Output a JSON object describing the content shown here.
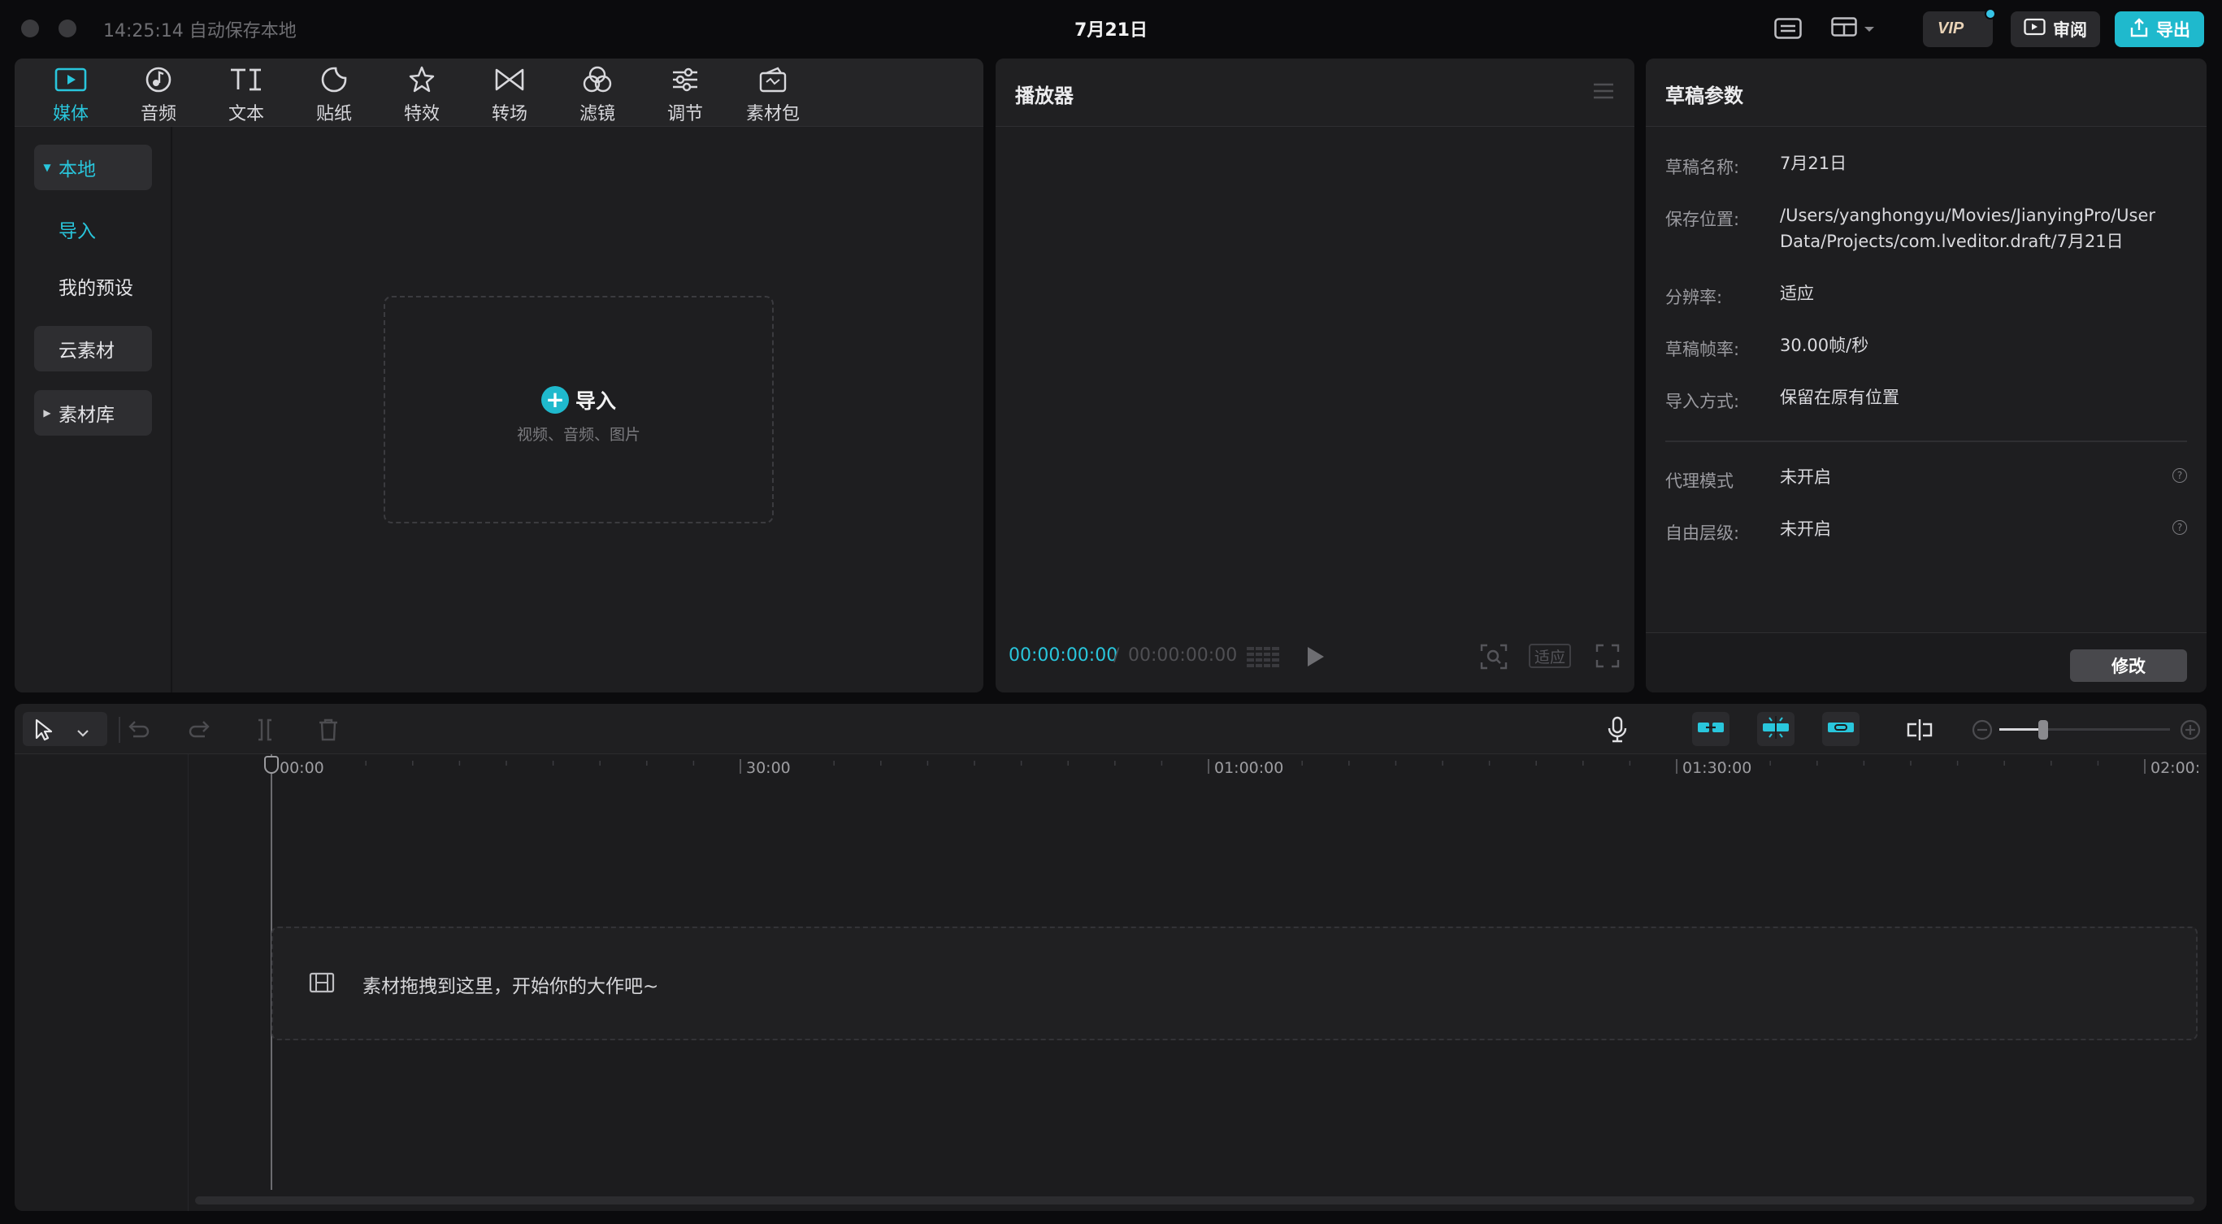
{
  "titlebar": {
    "autosave": "14:25:14 自动保存本地",
    "doc_title": "7月21日",
    "review_label": "审阅",
    "export_label": "导出",
    "vip_label": "VIP"
  },
  "media": {
    "tabs": [
      {
        "label": "媒体",
        "icon": "media-icon",
        "active": true
      },
      {
        "label": "音频",
        "icon": "audio-icon"
      },
      {
        "label": "文本",
        "icon": "text-icon"
      },
      {
        "label": "贴纸",
        "icon": "sticker-icon"
      },
      {
        "label": "特效",
        "icon": "effects-icon"
      },
      {
        "label": "转场",
        "icon": "transition-icon"
      },
      {
        "label": "滤镜",
        "icon": "filter-icon"
      },
      {
        "label": "调节",
        "icon": "adjust-icon"
      },
      {
        "label": "素材包",
        "icon": "asset-pack-icon"
      }
    ],
    "sidebar": {
      "local": "本地",
      "import": "导入",
      "presets": "我的预设",
      "cloud": "云素材",
      "library": "素材库"
    },
    "import_box": {
      "title": "导入",
      "subtitle": "视频、音频、图片"
    }
  },
  "player": {
    "title": "播放器",
    "current_time": "00:00:00:00",
    "separator": "/",
    "total_time": "00:00:00:00",
    "fit_label": "适应"
  },
  "params": {
    "title": "草稿参数",
    "rows": [
      {
        "label": "草稿名称:",
        "value": "7月21日"
      },
      {
        "label": "保存位置:",
        "value": "/Users/yanghongyu/Movies/JianyingPro/User Data/Projects/com.lveditor.draft/7月21日"
      },
      {
        "label": "分辨率:",
        "value": "适应"
      },
      {
        "label": "草稿帧率:",
        "value": "30.00帧/秒"
      },
      {
        "label": "导入方式:",
        "value": "保留在原有位置"
      }
    ],
    "proxy": {
      "label": "代理模式",
      "value": "未开启"
    },
    "free_layer": {
      "label": "自由层级:",
      "value": "未开启"
    },
    "modify_label": "修改"
  },
  "timeline": {
    "ruler": [
      "00:00",
      "30:00",
      "01:00:00",
      "01:30:00",
      "02:00:"
    ],
    "drop_hint": "素材拖拽到这里，开始你的大作吧~"
  },
  "colors": {
    "accent": "#1fb9cd",
    "panel": "#1e1e20",
    "background": "#0b0b0d"
  }
}
